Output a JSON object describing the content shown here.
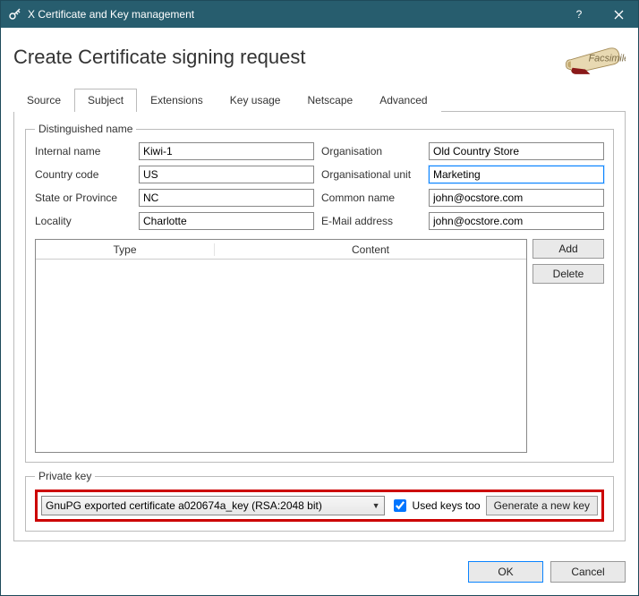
{
  "window": {
    "title": "X Certificate and Key management"
  },
  "page": {
    "heading": "Create Certificate signing request"
  },
  "tabs": {
    "source": "Source",
    "subject": "Subject",
    "extensions": "Extensions",
    "keyusage": "Key usage",
    "netscape": "Netscape",
    "advanced": "Advanced"
  },
  "dn": {
    "legend": "Distinguished name",
    "labels": {
      "internal_name": "Internal name",
      "country": "Country code",
      "state": "State or Province",
      "locality": "Locality",
      "organisation": "Organisation",
      "ou": "Organisational unit",
      "cn": "Common name",
      "email": "E-Mail address"
    },
    "values": {
      "internal_name": "Kiwi-1",
      "country": "US",
      "state": "NC",
      "locality": "Charlotte",
      "organisation": "Old Country Store",
      "ou": "Marketing",
      "cn": "john@ocstore.com",
      "email": "john@ocstore.com"
    }
  },
  "table": {
    "col_type": "Type",
    "col_content": "Content"
  },
  "buttons": {
    "add": "Add",
    "delete": "Delete",
    "ok": "OK",
    "cancel": "Cancel",
    "gen_key": "Generate a new key"
  },
  "pk": {
    "legend": "Private key",
    "selected": "GnuPG exported certificate a020674a_key (RSA:2048 bit)",
    "used_keys": "Used keys too"
  }
}
